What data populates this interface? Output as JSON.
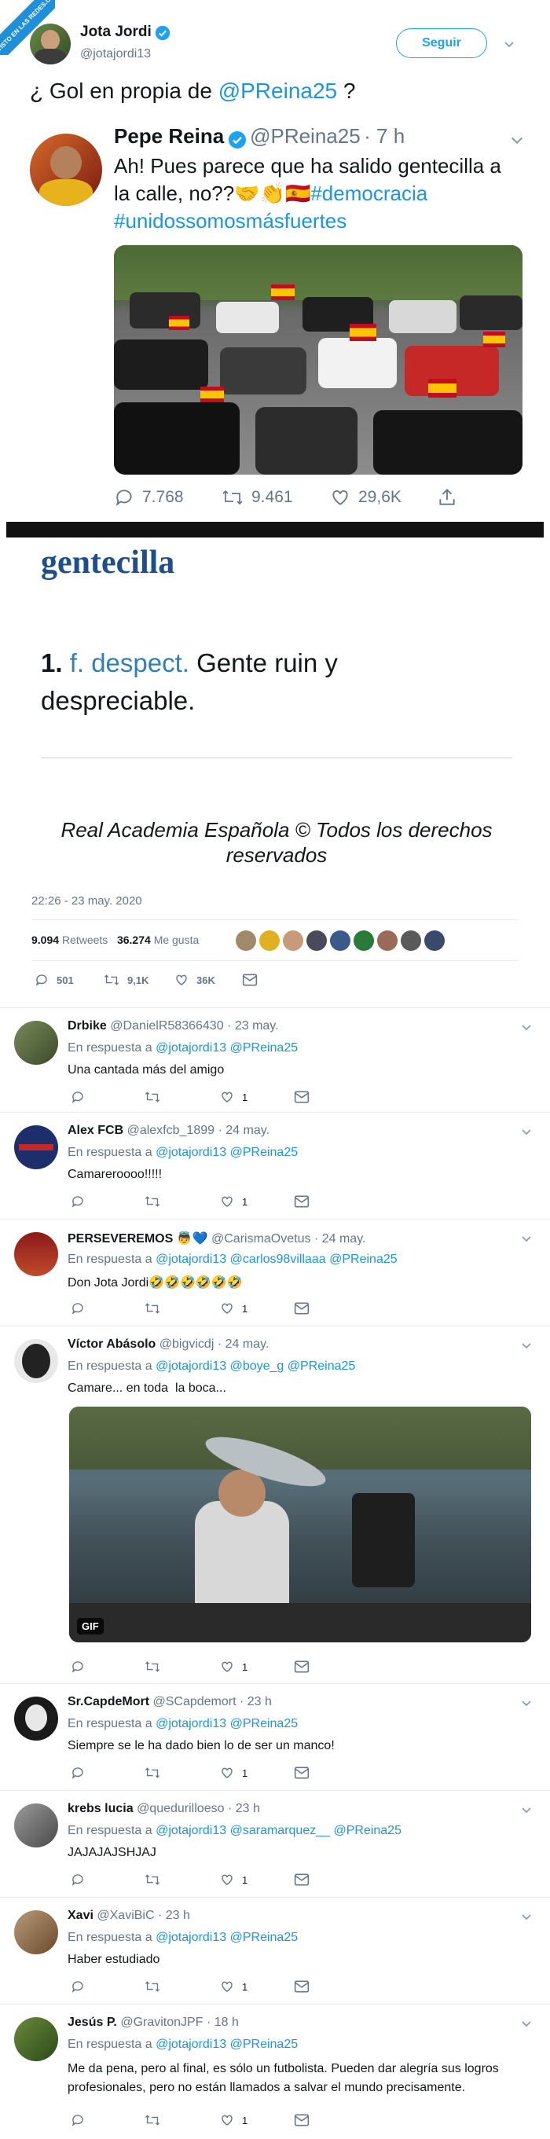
{
  "watermark": "VISTO EN LAS REDES.COM",
  "main": {
    "name": "Jota Jordi",
    "handle": "@jotajordi13",
    "follow_label": "Seguir",
    "text_prefix": "¿ Gol en propia de ",
    "mention": "@PReina25",
    "text_suffix": " ?"
  },
  "quoted": {
    "name": "Pepe Reina",
    "handle": "@PReina25",
    "time": "· 7 h",
    "text": "Ah! Pues parece que ha salido gentecilla a la calle, no??🤝👏🇪🇸",
    "hashtag1": "#democracia",
    "hashtag2": "#unidossomosmásfuertes",
    "replies": "7.768",
    "retweets": "9.461",
    "likes": "29,6K"
  },
  "dictionary": {
    "word": "gentecilla",
    "number": "1.",
    "abbr": "f. despect.",
    "definition": "Gente ruin y despreciable.",
    "footer": "Real Academia Española © Todos los derechos reservados"
  },
  "tweet_meta": {
    "timestamp": "22:26 - 23 may. 2020",
    "retweets_count": "9.094",
    "retweets_label": "Retweets",
    "likes_count": "36.274",
    "likes_label": "Me gusta",
    "reply_count": "501",
    "rt_count": "9,1K",
    "like_count": "36K"
  },
  "replies": [
    {
      "name": "Drbike",
      "handle": "@DanielR58366430",
      "time": "· 23 may.",
      "prefix": "En respuesta a",
      "mentions": "@jotajordi13 @PReina25",
      "text": "Una cantada más del amigo",
      "likes": "1",
      "avatar_color": "#5a6b3a"
    },
    {
      "name": "Alex FCB",
      "handle": "@alexfcb_1899",
      "time": "· 24 may.",
      "prefix": "En respuesta a",
      "mentions": "@jotajordi13 @PReina25",
      "text": "Camareroooo!!!!!",
      "likes": "1",
      "avatar_color": "#1c2e6b"
    },
    {
      "name": "PERSEVEREMOS 👼💙",
      "handle": "@CarismaOvetus",
      "time": "· 24 may.",
      "prefix": "En respuesta a",
      "mentions": "@jotajordi13 @carlos98villaaa @PReina25",
      "text": "Don Jota Jordi🤣🤣🤣🤣🤣🤣",
      "likes": "1",
      "avatar_color": "#8b1a1a"
    },
    {
      "name": "Víctor Abásolo",
      "handle": "@bigvicdj",
      "time": "· 24 may.",
      "prefix": "En respuesta a",
      "mentions": "@jotajordi13 @boye_g @PReina25",
      "text": "Camare... en toda  la boca...",
      "likes": "1",
      "avatar_color": "#333333",
      "gif_label": "GIF"
    },
    {
      "name": "Sr.CapdeMort",
      "handle": "@SCapdemort",
      "time": "· 23 h",
      "prefix": "En respuesta a",
      "mentions": "@jotajordi13 @PReina25",
      "text": "Siempre se le ha dado bien lo de ser un manco!",
      "likes": "1",
      "avatar_color": "#1a1a1a"
    },
    {
      "name": "krebs lucia",
      "handle": "@quedurilloeso",
      "time": "· 23 h",
      "prefix": "En respuesta a",
      "mentions": "@jotajordi13 @saramarquez__ @PReina25",
      "text": "JAJAJAJSHJAJ",
      "likes": "1",
      "avatar_color": "#6b6b6b"
    },
    {
      "name": "Xavi",
      "handle": "@XaviBiC",
      "time": "· 23 h",
      "prefix": "En respuesta a",
      "mentions": "@jotajordi13 @PReina25",
      "text": "Haber estudiado",
      "likes": "1",
      "avatar_color": "#8a6a4a"
    },
    {
      "name": "Jesús P.",
      "handle": "@GravitonJPF",
      "time": "· 18 h",
      "prefix": "En respuesta a",
      "mentions": "@jotajordi13 @PReina25",
      "text": "Me da pena, pero al final, es sólo un futbolista. Pueden dar alegría sus logros profesionales, pero no están llamados a salvar el mundo precisamente.",
      "likes": "1",
      "avatar_color": "#3a5a2a"
    }
  ],
  "colors": {
    "accent": "#1da1f2",
    "rae_blue": "#1f4e8c",
    "divider": "#e6ecf0"
  }
}
